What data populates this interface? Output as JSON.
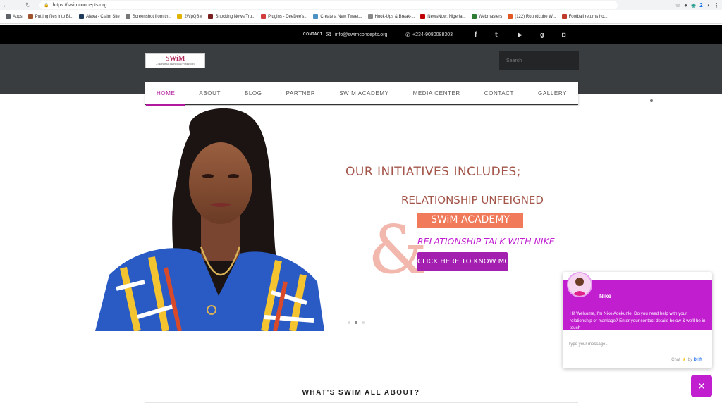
{
  "browser": {
    "url": "https://swimconcepts.org",
    "bookmarks": [
      {
        "label": "Apps",
        "color": "#5f6368"
      },
      {
        "label": "Putting files into Bl...",
        "color": "#a0522d"
      },
      {
        "label": "Alexa - Claim Site",
        "color": "#1f3b5a"
      },
      {
        "label": "Screenshot from th...",
        "color": "#777777"
      },
      {
        "label": "2WpQBM",
        "color": "#e0b300"
      },
      {
        "label": "Shocking News Tru...",
        "color": "#7a1f1f"
      },
      {
        "label": "Plugins - DeeDee's...",
        "color": "#d23c3c"
      },
      {
        "label": "Create a New Tweet...",
        "color": "#4a90c2"
      },
      {
        "label": "Hook-Ups & Break-...",
        "color": "#888888"
      },
      {
        "label": "NewsNow: Nigeria...",
        "color": "#c00000"
      },
      {
        "label": "Webmasters",
        "color": "#2e7d32"
      },
      {
        "label": "(122) Roundcube W...",
        "color": "#e25822"
      },
      {
        "label": "Football returns ho...",
        "color": "#c0392b"
      }
    ],
    "ext_badge": "2"
  },
  "topbar": {
    "contact_label": "CONTACT",
    "email": "info@swimconcepts.org",
    "phone": "+234-9080088303",
    "social_icons": [
      "facebook-icon",
      "twitter-icon",
      "youtube-icon",
      "google-plus-icon",
      "instagram-icon"
    ]
  },
  "logo": {
    "title": "SWiM",
    "tagline": "A VERSATILE PERSONALITY MISSION"
  },
  "search": {
    "placeholder": "Search"
  },
  "nav": {
    "items": [
      {
        "label": "HOME",
        "active": true
      },
      {
        "label": "ABOUT",
        "active": false
      },
      {
        "label": "BLOG",
        "active": false
      },
      {
        "label": "PARTNER",
        "active": false
      },
      {
        "label": "SWIM ACADEMY",
        "active": false
      },
      {
        "label": "MEDIA CENTER",
        "active": false
      },
      {
        "label": "CONTACT",
        "active": false
      },
      {
        "label": "GALLERY",
        "active": false
      }
    ]
  },
  "hero": {
    "heading": "OUR INITIATIVES INCLUDES;",
    "line1": "RELATIONSHIP UNFEIGNED",
    "badge": "SWiM ACADEMY",
    "ampersand": "&",
    "line3": "RELATIONSHIP TALK WITH NIKE",
    "cta": "CLICK HERE TO KNOW MORE",
    "colors": {
      "heading": "#a4554a",
      "badge_bg": "#f07a5a",
      "line3": "#c11ed0",
      "cta_bg": "#a21fb0",
      "amp": "#f2b8ad"
    },
    "slide_count": 3,
    "active_slide": 2
  },
  "section": {
    "title": "WHAT'S SWIM ALL ABOUT?"
  },
  "chat": {
    "name": "Nike",
    "message": "Hi! Welcome, I'm Nike Adekunle. Do you need help with your relationship or marriage? Enter your contact details below & we'll be in touch",
    "input_placeholder": "Type your message...",
    "footer_prefix": "Chat",
    "footer_by": "by",
    "footer_brand": "Drift",
    "accent": "#c11ed0"
  }
}
